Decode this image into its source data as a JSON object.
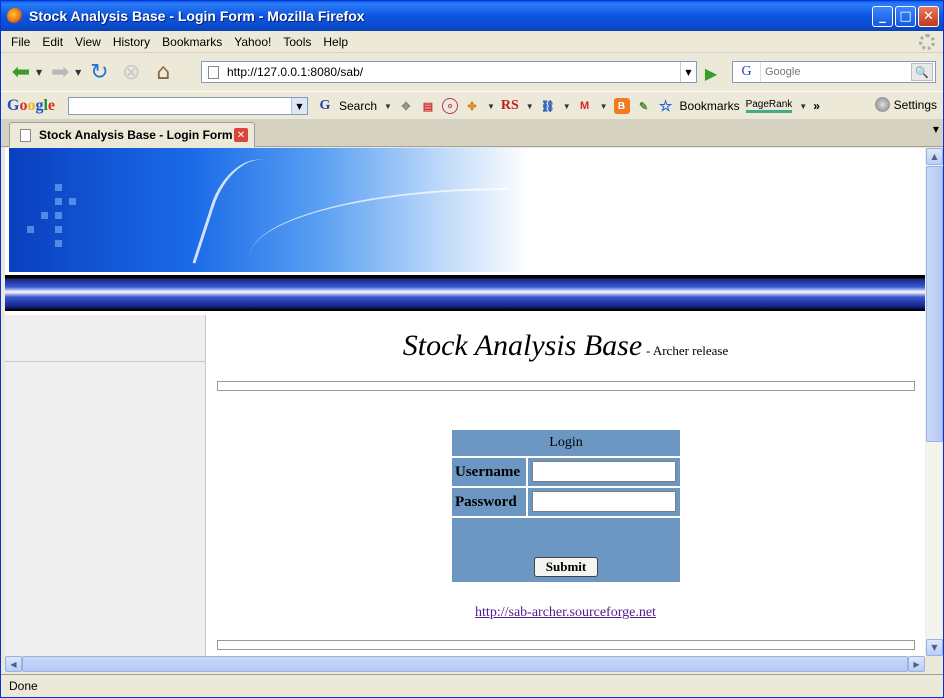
{
  "window": {
    "title": "Stock Analysis Base - Login Form - Mozilla Firefox"
  },
  "menu": [
    "File",
    "Edit",
    "View",
    "History",
    "Bookmarks",
    "Yahoo!",
    "Tools",
    "Help"
  ],
  "navbar": {
    "url": "http://127.0.0.1:8080/sab/",
    "search_engine": "G",
    "search_placeholder": "Google"
  },
  "google_toolbar": {
    "logo": [
      "G",
      "o",
      "o",
      "g",
      "l",
      "e"
    ],
    "search_label": "Search",
    "rs_label": "RS",
    "gmail_label": "M",
    "bookmarks_label": "Bookmarks",
    "pagerank_label": "PageRank",
    "more_label": "»",
    "settings_label": "Settings"
  },
  "tab": {
    "label": "Stock Analysis Base - Login Form"
  },
  "page": {
    "title": "Stock Analysis Base",
    "subtitle": "- Archer release",
    "login": {
      "heading": "Login",
      "username_label": "Username",
      "password_label": "Password",
      "username_value": "",
      "password_value": "",
      "submit_label": "Submit"
    },
    "link": "http://sab-archer.sourceforge.net"
  },
  "status": "Done",
  "colors": {
    "login_panel": "#6b97c2",
    "link_visited": "#551a8b",
    "titlebar": "#0d56e0"
  }
}
